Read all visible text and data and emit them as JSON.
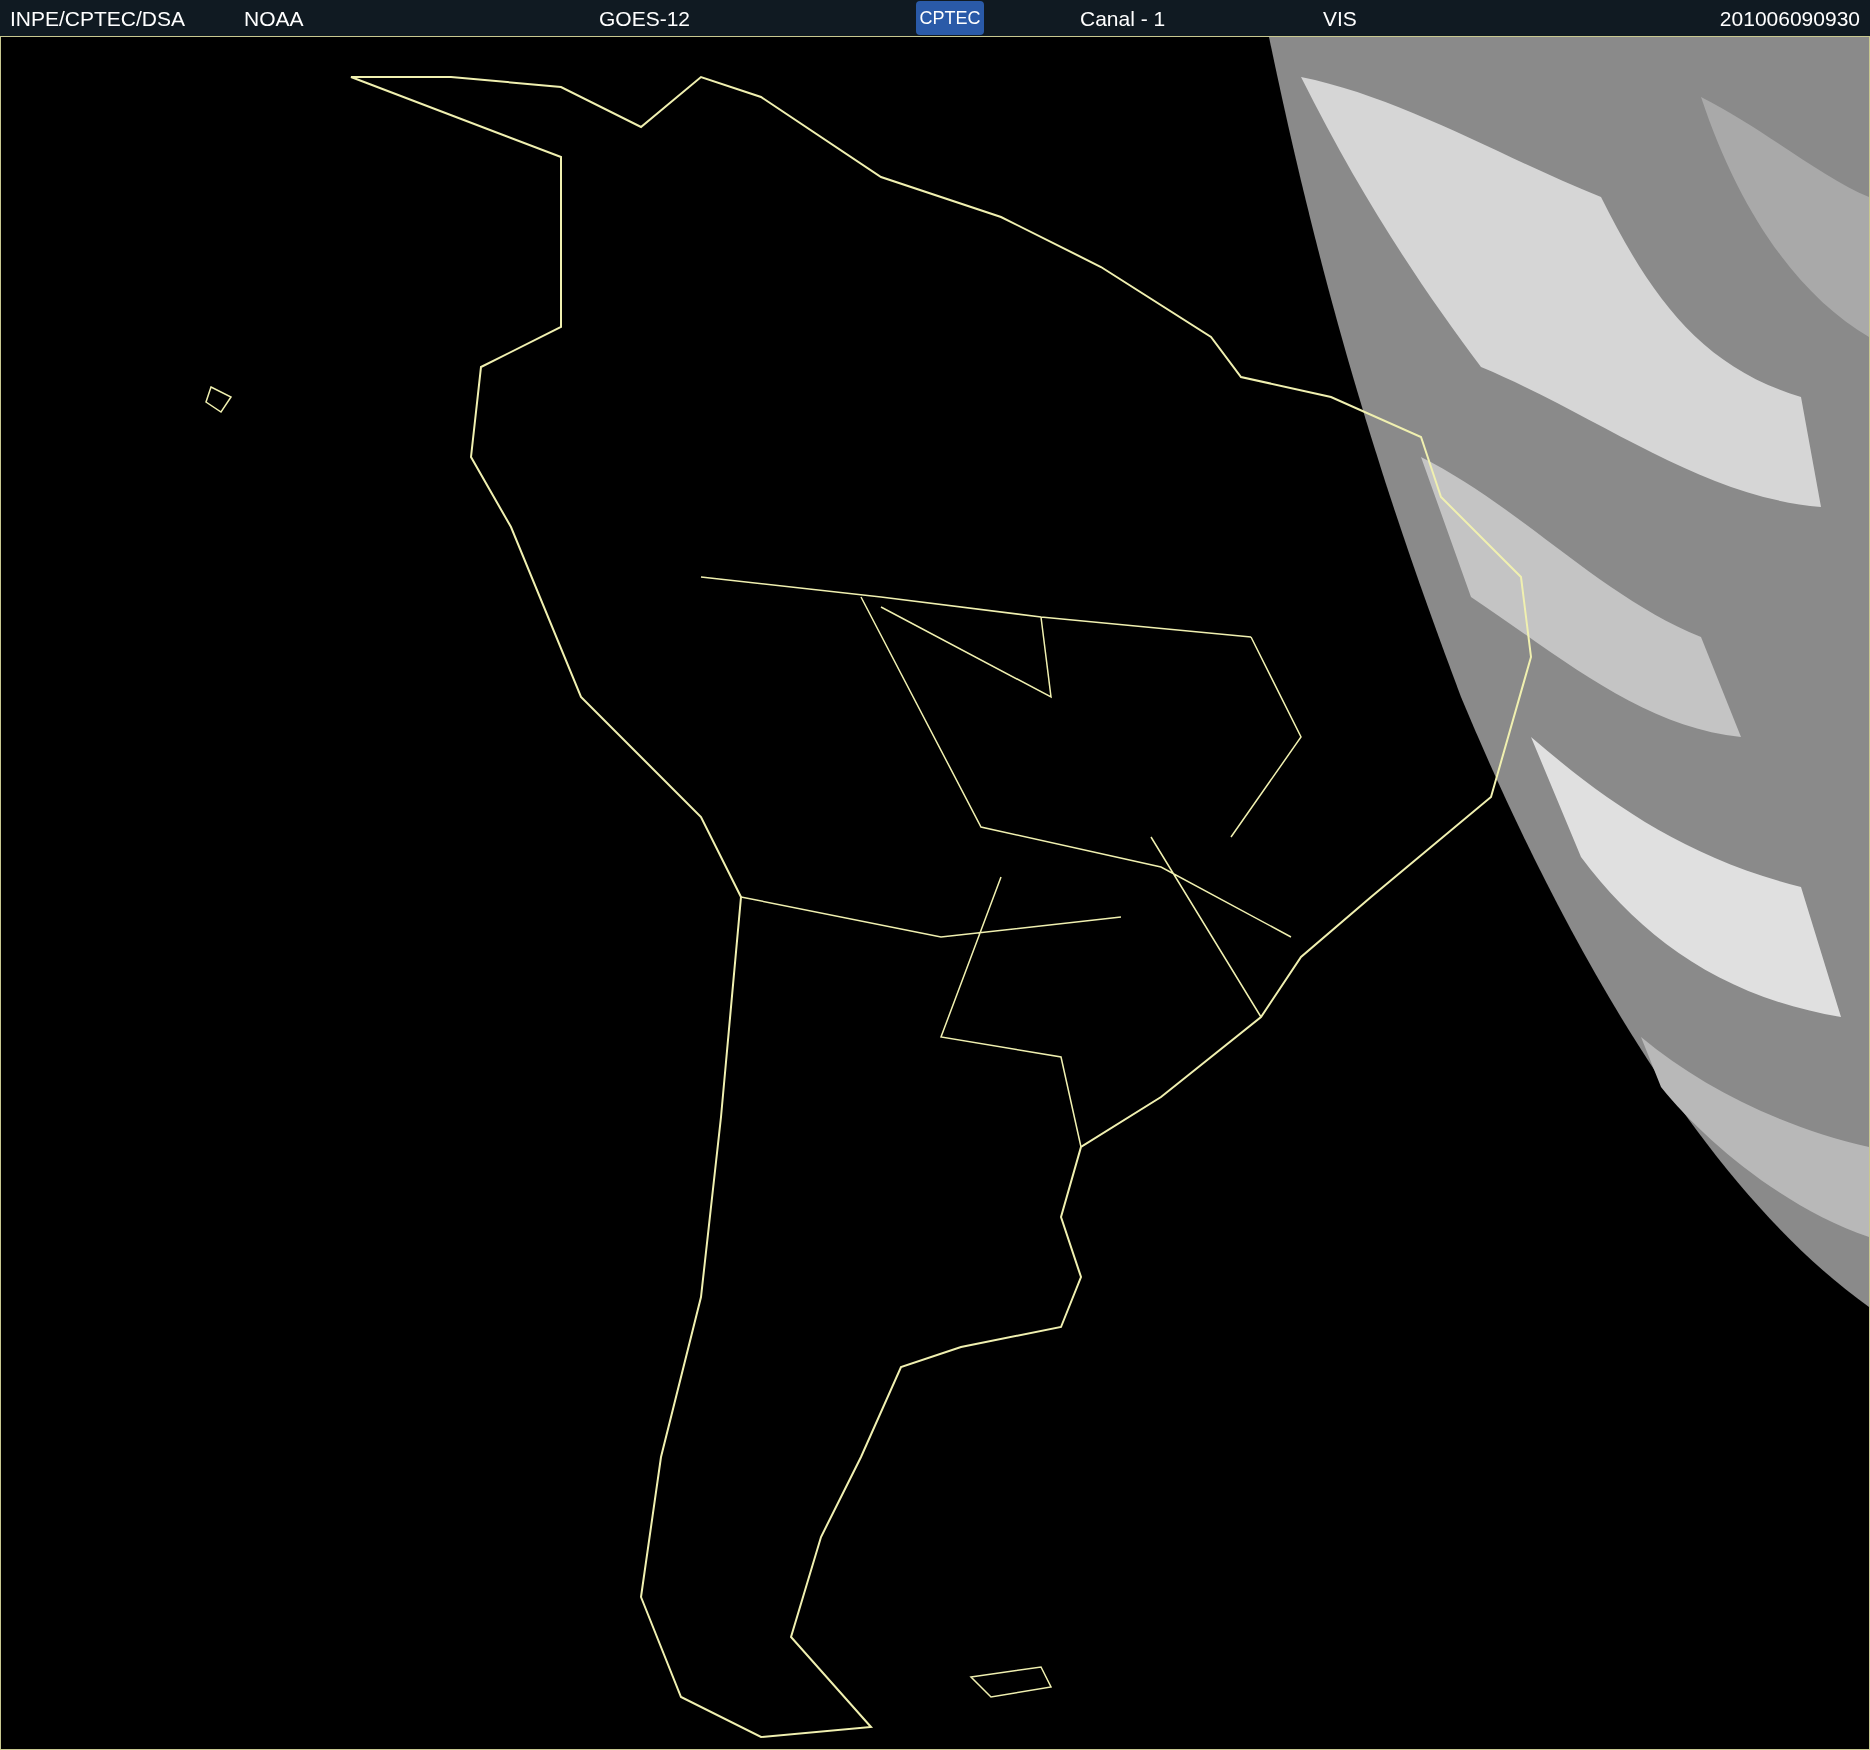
{
  "header": {
    "source": "INPE/CPTEC/DSA",
    "agency": "NOAA",
    "satellite": "GOES-12",
    "logo": "CPTEC",
    "channel": "Canal - 1",
    "band": "VIS",
    "timestamp": "201006090930"
  }
}
